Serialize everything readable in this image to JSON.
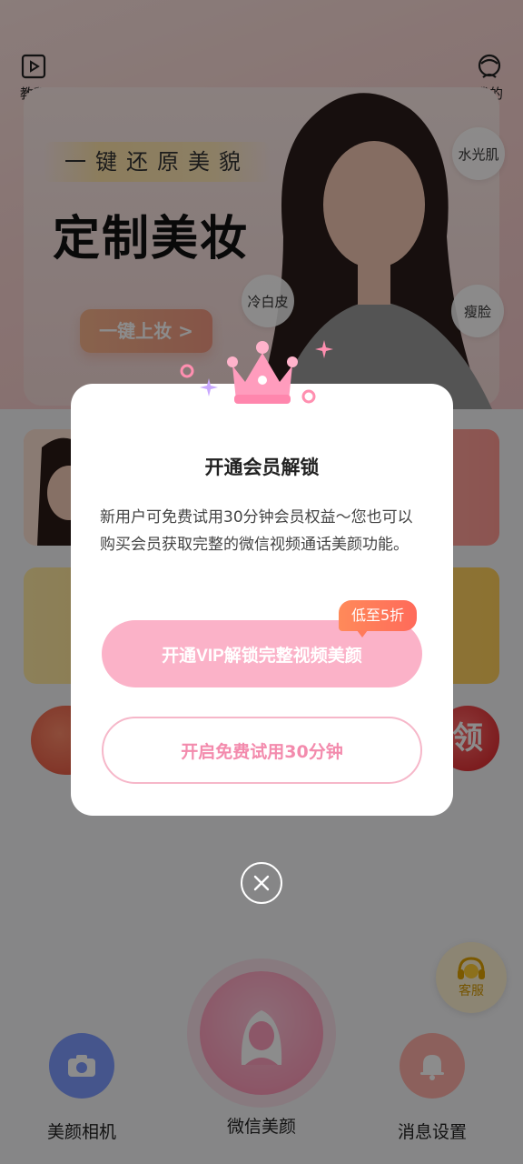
{
  "topnav": {
    "tutorial_label": "教程",
    "mine_label": "我的"
  },
  "banner": {
    "subtitle": "一键还原美貌",
    "title": "定制美妆",
    "cta_label": "一键上妆 >",
    "tags": [
      "水光肌",
      "冷白皮",
      "瘦脸"
    ]
  },
  "decor": {
    "right_badge_text": "领"
  },
  "service": {
    "label": "客服"
  },
  "bottom_nav": {
    "camera_label": "美颜相机",
    "wechat_label": "微信美颜",
    "notify_label": "消息设置"
  },
  "modal": {
    "title": "开通会员解锁",
    "description": "新用户可免费试用30分钟会员权益～您也可以购买会员获取完整的微信视频通话美颜功能。",
    "vip_button_label": "开通VIP解锁完整视频美颜",
    "discount_badge": "低至5折",
    "trial_button_label": "开启免费试用30分钟"
  },
  "colors": {
    "accent_pink": "#fbb2c8",
    "trial_text": "#f38bad",
    "discount_orange": "#ff7a5a"
  }
}
